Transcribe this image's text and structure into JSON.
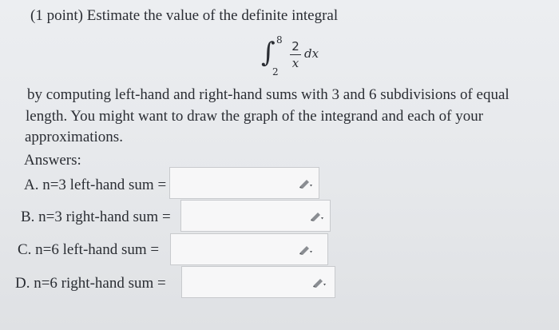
{
  "problem": {
    "intro": "(1 point) Estimate the value of the definite integral",
    "integral": {
      "upper_limit": "8",
      "lower_limit": "2",
      "numerator": "2",
      "denominator": "x",
      "differential": "dx"
    },
    "line1": "by computing left-hand and right-hand sums with 3 and 6 subdivisions of equal",
    "line2": "length. You might want to draw the graph of the integrand and each of your",
    "line3": "approximations.",
    "answers_label": "Answers:"
  },
  "answers": [
    {
      "label": "A. n=3 left-hand sum =",
      "value": ""
    },
    {
      "label": "B. n=3 right-hand sum =",
      "value": ""
    },
    {
      "label": "C. n=6 left-hand sum =",
      "value": ""
    },
    {
      "label": "D. n=6 right-hand sum =",
      "value": ""
    }
  ],
  "icons": {
    "edit": "pencil-icon"
  }
}
